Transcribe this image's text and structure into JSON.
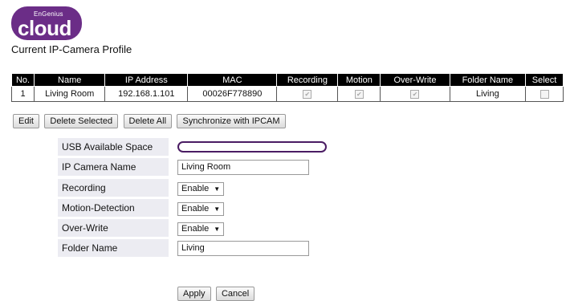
{
  "logo": {
    "brand_small": "EnGenius",
    "brand_big": "cloud"
  },
  "page_title": "Current IP-Camera Profile",
  "table": {
    "headers": [
      "No.",
      "Name",
      "IP Address",
      "MAC",
      "Recording",
      "Motion",
      "Over-Write",
      "Folder Name",
      "Select"
    ],
    "rows": [
      {
        "no": "1",
        "name": "Living Room",
        "ip": "192.168.1.101",
        "mac": "00026F778890",
        "recording": true,
        "motion": true,
        "overwrite": true,
        "folder": "Living",
        "select": false
      }
    ]
  },
  "buttons": {
    "edit": "Edit",
    "delete_selected": "Delete Selected",
    "delete_all": "Delete All",
    "sync": "Synchronize with IPCAM"
  },
  "form": {
    "usb_label": "USB Available Space",
    "usb_used_fraction": 0,
    "camera_name_label": "IP Camera Name",
    "camera_name_value": "Living Room",
    "recording_label": "Recording",
    "recording_value": "Enable",
    "motion_label": "Motion-Detection",
    "motion_value": "Enable",
    "overwrite_label": "Over-Write",
    "overwrite_value": "Enable",
    "folder_label": "Folder Name",
    "folder_value": "Living"
  },
  "actions": {
    "apply": "Apply",
    "cancel": "Cancel"
  },
  "colors": {
    "brand": "#6b2d87",
    "header_bg": "#000000"
  }
}
